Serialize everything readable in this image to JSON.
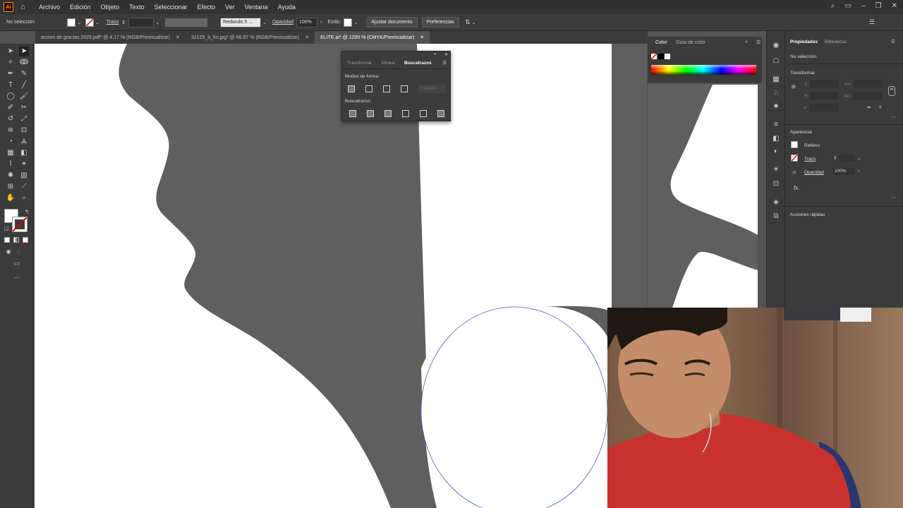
{
  "menubar": {
    "logo": "Ai",
    "items": [
      "Archivo",
      "Edición",
      "Objeto",
      "Texto",
      "Seleccionar",
      "Efecto",
      "Ver",
      "Ventana",
      "Ayuda"
    ]
  },
  "controlbar": {
    "selection": "No selección",
    "stroke_label": "Trazo",
    "brush": "Redondo 5 ...",
    "opacity_label": "Opacidad",
    "opacity_value": "100%",
    "style_label": "Estilo:",
    "fit_button": "Ajustar documento",
    "prefs_button": "Preferencias"
  },
  "tabs": [
    {
      "label": "accion de gracias 2025.pdf* @ 4.17 % (RGB/Previsualizar)",
      "active": false
    },
    {
      "label": "32129_b_fm.jpg* @ 66.67 % (RGB/Previsualizar)",
      "active": false
    },
    {
      "label": "ELITE.ai* @ 1200 % (CMYK/Previsualizar)",
      "active": true
    }
  ],
  "pathfinder": {
    "tabs": [
      "Transformar",
      "Alinear",
      "Buscatrazos"
    ],
    "shape_modes_label": "Modos de forma:",
    "expand_button": "Expandir",
    "pathfinders_label": "Buscatrazos:"
  },
  "color_panel": {
    "tabs": [
      "Color",
      "Guía de color"
    ]
  },
  "properties": {
    "tabs": [
      "Propiedades",
      "Bibliotecas"
    ],
    "selection": "No selección",
    "transform_label": "Transformar",
    "x_label": "X:",
    "y_label": "Y:",
    "w_label": "An.:",
    "h_label": "Al.:",
    "appearance_label": "Apariencia",
    "fill_label": "Relleno",
    "stroke_label": "Trazo",
    "opacity_label": "Opacidad",
    "opacity_value": "100%",
    "fx_label": "fx.",
    "quick_actions_label": "Acciones rápidas"
  }
}
